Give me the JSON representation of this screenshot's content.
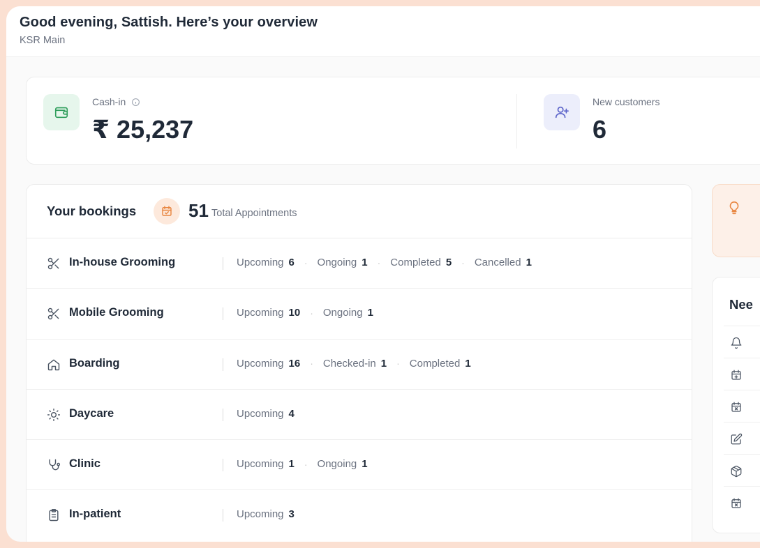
{
  "header": {
    "title": "Good evening, Sattish. Here’s your overview",
    "subtitle": "KSR Main"
  },
  "stats": {
    "cash_in": {
      "label": "Cash-in",
      "value": "₹ 25,237",
      "icon": "wallet-icon"
    },
    "new_customers": {
      "label": "New customers",
      "value": "6",
      "icon": "user-plus-icon"
    }
  },
  "bookings": {
    "title": "Your bookings",
    "total_count": "51",
    "total_label": "Total Appointments",
    "rows": [
      {
        "label": "In-house Grooming",
        "icon": "scissors-icon",
        "chips": [
          {
            "label": "Upcoming",
            "count": "6"
          },
          {
            "label": "Ongoing",
            "count": "1"
          },
          {
            "label": "Completed",
            "count": "5"
          },
          {
            "label": "Cancelled",
            "count": "1"
          }
        ]
      },
      {
        "label": "Mobile Grooming",
        "icon": "scissors-icon",
        "chips": [
          {
            "label": "Upcoming",
            "count": "10"
          },
          {
            "label": "Ongoing",
            "count": "1"
          }
        ]
      },
      {
        "label": "Boarding",
        "icon": "home-icon",
        "chips": [
          {
            "label": "Upcoming",
            "count": "16"
          },
          {
            "label": "Checked-in",
            "count": "1"
          },
          {
            "label": "Completed",
            "count": "1"
          }
        ]
      },
      {
        "label": "Daycare",
        "icon": "sun-icon",
        "chips": [
          {
            "label": "Upcoming",
            "count": "4"
          }
        ]
      },
      {
        "label": "Clinic",
        "icon": "stethoscope-icon",
        "chips": [
          {
            "label": "Upcoming",
            "count": "1"
          },
          {
            "label": "Ongoing",
            "count": "1"
          }
        ]
      },
      {
        "label": "In-patient",
        "icon": "clipboard-icon",
        "chips": [
          {
            "label": "Upcoming",
            "count": "3"
          }
        ]
      }
    ]
  },
  "needs": {
    "title": "Nee",
    "icons": [
      "bell-icon",
      "calendar-plus-icon",
      "calendar-x-icon",
      "edit-icon",
      "package-icon",
      "calendar-x-icon"
    ]
  },
  "colors": {
    "accent_orange": "#e8853f",
    "wallet_green": "#2f9e5b",
    "user_lavender": "#5b63c9"
  }
}
